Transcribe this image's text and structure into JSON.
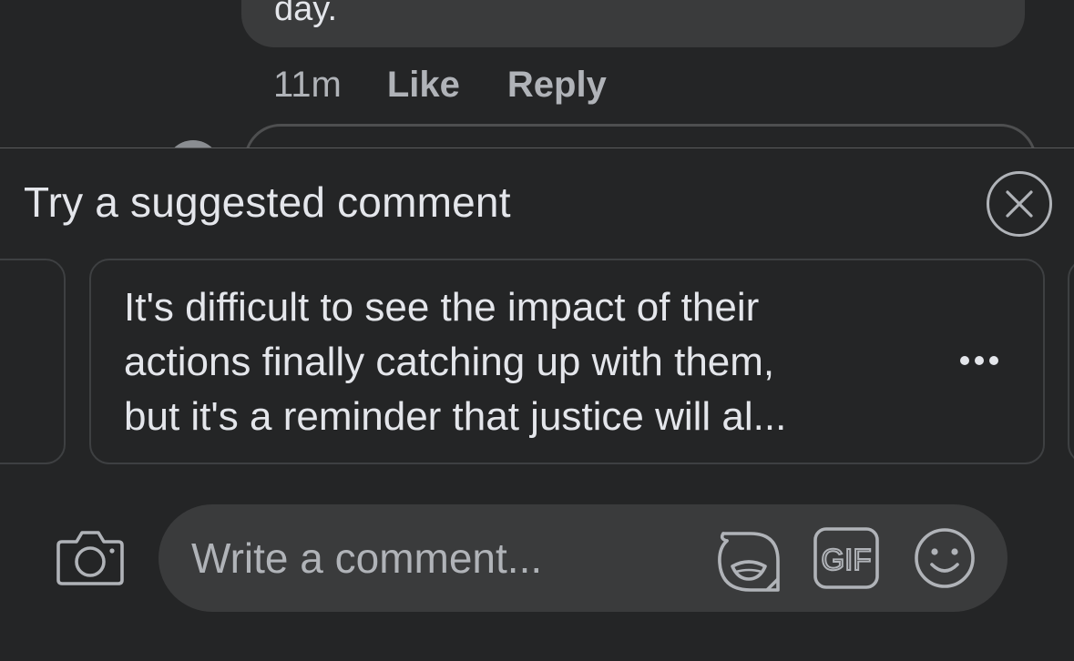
{
  "thread": {
    "comment_text_tail": "day.",
    "timestamp": "11m",
    "like_label": "Like",
    "reply_label": "Reply"
  },
  "suggestions": {
    "title": "Try a suggested comment",
    "cards": [
      {
        "lines": [
          "It's difficult to see the impact of their",
          "actions finally catching up with them,",
          "but it's a reminder that justice will al..."
        ]
      }
    ]
  },
  "composer": {
    "placeholder": "Write a comment...",
    "gif_label": "GIF"
  },
  "icons": {
    "close": "close-icon",
    "more": "more-dots-icon",
    "camera": "camera-icon",
    "sticker": "sticker-icon",
    "gif": "gif-icon",
    "emoji": "emoji-icon"
  },
  "colors": {
    "background": "#242526",
    "bubble": "#3a3b3c",
    "primary_text": "#e4e6eb",
    "secondary_text": "#b0b3b8",
    "card_border": "#3e4042"
  }
}
